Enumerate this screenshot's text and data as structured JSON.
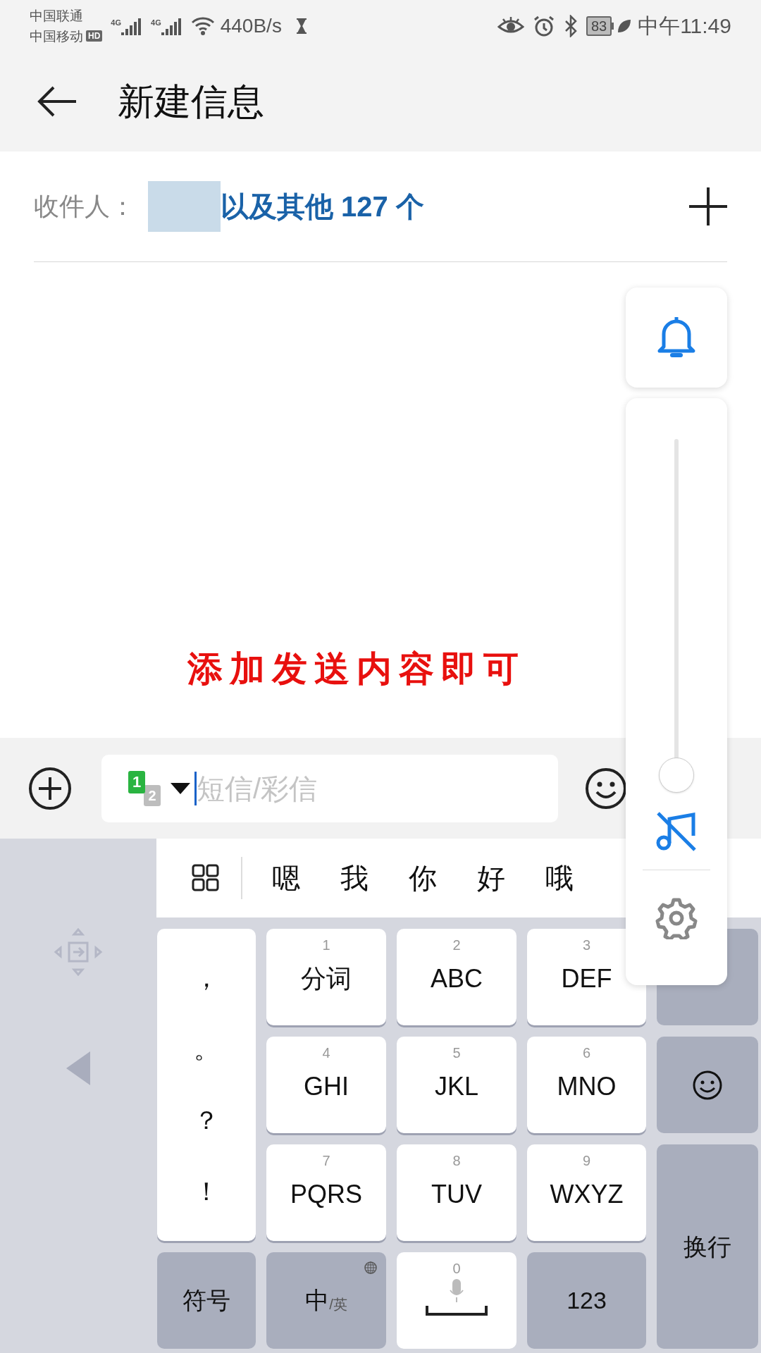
{
  "status_bar": {
    "carrier_1": "中国联通",
    "carrier_2": "中国移动",
    "hd_badge": "HD",
    "network_1": "4G",
    "network_2": "4G",
    "speed": "440B/s",
    "battery": "83",
    "time": "中午11:49"
  },
  "header": {
    "title": "新建信息"
  },
  "recipients": {
    "label": "收件人：",
    "others": "以及其他 127 个"
  },
  "message_area": {
    "note": "添加发送内容即可"
  },
  "compose": {
    "sim_primary": "1",
    "sim_secondary": "2",
    "placeholder": "短信/彩信"
  },
  "candidates": [
    "嗯",
    "我",
    "你",
    "好",
    "哦"
  ],
  "punctuation": [
    "，",
    "。",
    "？",
    "！"
  ],
  "keys": [
    {
      "number": "1",
      "letters": "分词"
    },
    {
      "number": "2",
      "letters": "ABC"
    },
    {
      "number": "3",
      "letters": "DEF"
    },
    {
      "number": "4",
      "letters": "GHI"
    },
    {
      "number": "5",
      "letters": "JKL"
    },
    {
      "number": "6",
      "letters": "MNO"
    },
    {
      "number": "7",
      "letters": "PQRS"
    },
    {
      "number": "8",
      "letters": "TUV"
    },
    {
      "number": "9",
      "letters": "WXYZ"
    }
  ],
  "bottom_keys": {
    "symbols": "符号",
    "lang_main": "中",
    "lang_alt": "/英",
    "space_number": "0",
    "numbers": "123",
    "enter": "换行"
  },
  "volume_panel": {
    "level": 0
  }
}
